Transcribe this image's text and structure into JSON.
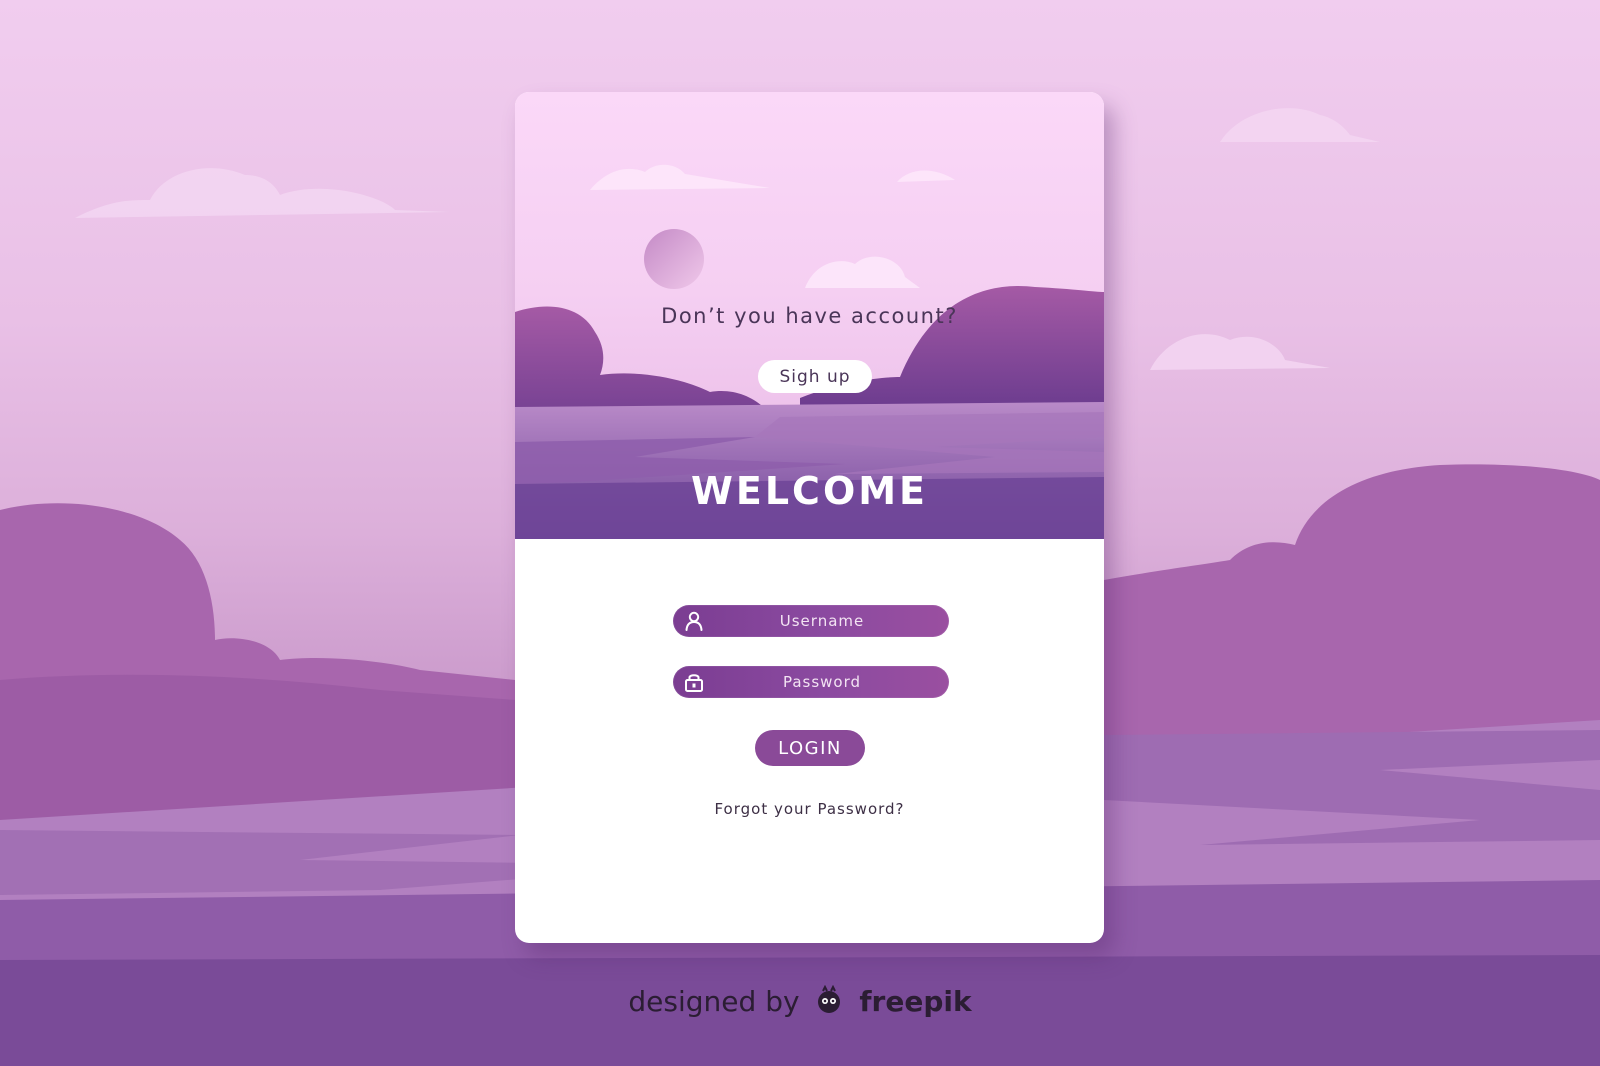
{
  "signup_prompt": {
    "question": "Don’t you have account?",
    "signup_label": "Sigh up"
  },
  "welcome_heading": "WELCOME",
  "login_form": {
    "username_placeholder": "Username",
    "password_placeholder": "Password",
    "login_label": "LOGIN",
    "forgot_label": "Forgot your Password?"
  },
  "icons": {
    "username": "user-icon",
    "password": "lock-icon",
    "brand": "freepik-logo-icon"
  },
  "attribution": {
    "prefix": "designed by",
    "brand": "freepik"
  },
  "colors": {
    "accent_purple": "#8a4a98",
    "field_purple": "#7b3d92",
    "card_white": "#ffffff",
    "text_dark": "#3d2f45"
  }
}
